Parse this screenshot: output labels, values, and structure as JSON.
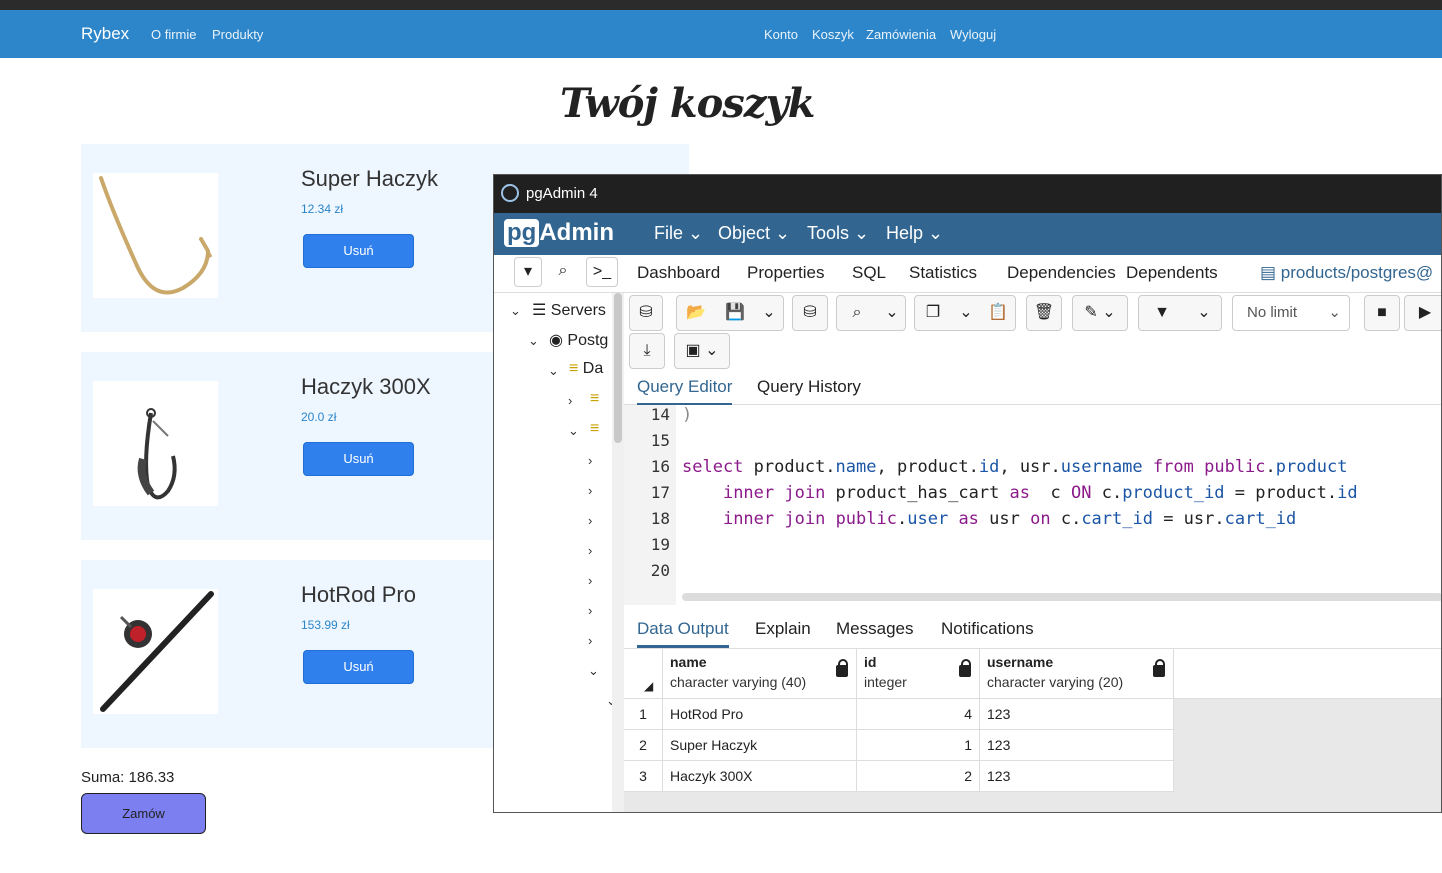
{
  "navbar": {
    "brand": "Rybex",
    "left_links": [
      "O firmie",
      "Produkty"
    ],
    "right_links": [
      "Konto",
      "Koszyk",
      "Zamówienia",
      "Wyloguj"
    ],
    "color": "#2c86c9"
  },
  "page_title": "Twój koszyk",
  "cart": {
    "items": [
      {
        "name": "Super Haczyk",
        "price": "12.34 zł",
        "remove_label": "Usuń"
      },
      {
        "name": "Haczyk 300X",
        "price": "20.0 zł",
        "remove_label": "Usuń"
      },
      {
        "name": "HotRod Pro",
        "price": "153.99 zł",
        "remove_label": "Usuń"
      }
    ],
    "sum": "Suma: 186.33",
    "order_label": "Zamów"
  },
  "pgadmin": {
    "window_title": "pgAdmin 4",
    "logo_pg": "pg",
    "logo_admin": "Admin",
    "menus": [
      "File",
      "Object",
      "Tools",
      "Help"
    ],
    "tabs": [
      "Dashboard",
      "Properties",
      "SQL",
      "Statistics",
      "Dependencies",
      "Dependents",
      "products/postgres@"
    ],
    "tree": {
      "servers": "Servers",
      "postgres": "Postg",
      "databases": "Da"
    },
    "limit_select": "No limit",
    "editor_tabs": [
      "Query Editor",
      "Query History"
    ],
    "line_numbers": [
      "14",
      "15",
      "16",
      "17",
      "18",
      "19",
      "20"
    ],
    "line14": ")",
    "output_tabs": [
      "Data Output",
      "Explain",
      "Messages",
      "Notifications"
    ],
    "columns": [
      {
        "name": "name",
        "type": "character varying (40)"
      },
      {
        "name": "id",
        "type": "integer"
      },
      {
        "name": "username",
        "type": "character varying (20)"
      }
    ],
    "rows": [
      {
        "num": "1",
        "name": "HotRod Pro",
        "id": "4",
        "username": "123"
      },
      {
        "num": "2",
        "name": "Super Haczyk",
        "id": "1",
        "username": "123"
      },
      {
        "num": "3",
        "name": "Haczyk 300X",
        "id": "2",
        "username": "123"
      }
    ]
  }
}
